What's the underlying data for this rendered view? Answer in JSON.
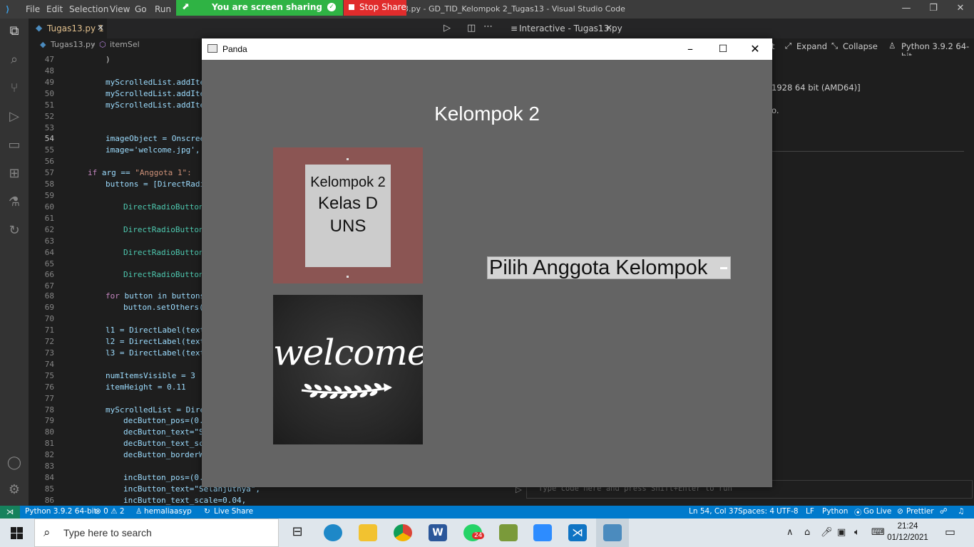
{
  "vscode": {
    "menu": [
      "File",
      "Edit",
      "Selection",
      "View",
      "Go",
      "Run"
    ],
    "window_title": "3.py - GD_TID_Kelompok 2_Tugas13 - Visual Studio Code",
    "editor_tab": {
      "label": "Tugas13.py 1",
      "close": "✕"
    },
    "breadcrumb": {
      "file": "Tugas13.py",
      "symbol": "itemSel"
    },
    "line_numbers": [
      "47",
      "48",
      "49",
      "50",
      "51",
      "52",
      "53",
      "54",
      "55",
      "56",
      "57",
      "58",
      "59",
      "60",
      "61",
      "62",
      "63",
      "64",
      "65",
      "66",
      "67",
      "68",
      "69",
      "70",
      "71",
      "72",
      "73",
      "74",
      "75",
      "76",
      "77",
      "78",
      "79",
      "80",
      "81",
      "82",
      "83",
      "84",
      "85",
      "86"
    ],
    "code": {
      "l47": ")",
      "l49": "myScrolledList.addIte",
      "l50": "myScrolledList.addIte",
      "l51": "myScrolledList.addIte",
      "l54": "imageObject = Onscree",
      "l55": "image='welcome.jpg',",
      "l57_kw": "if",
      "l57_rest": " arg == ",
      "l57_str": "\"Anggota 1\":",
      "l58": "buttons = [DirectRadi",
      "l60": "DirectRadioButton",
      "l62": "DirectRadioButton",
      "l64": "DirectRadioButton",
      "l66": "DirectRadioButton",
      "l68_kw": "for",
      "l68_rest": " button in buttons",
      "l69": "button.setOthers(",
      "l71": "l1 = DirectLabel(text",
      "l72": "l2 = DirectLabel(text",
      "l73": "l3 = DirectLabel(text",
      "l75": "numItemsVisible = 3",
      "l76": "itemHeight = 0.11",
      "l78": "myScrolledList = Dire",
      "l79": "decButton_pos=(0.",
      "l80": "decButton_text=\"S",
      "l81": "decButton_text_sc",
      "l82": "decButton_borderW",
      "l84": "incButton_pos=(0.",
      "l85": "incButton_text=\"Selanjutnya\",",
      "l86": "incButton_text_scale=0.04,"
    },
    "interactive": {
      "tab_label": "Interactive - Tugas13.py",
      "toolbar": {
        "t": "t",
        "expand": "Expand",
        "collapse": "Collapse",
        "kernel": "Python 3.9.2 64-bit"
      },
      "output_line1": "1928 64 bit (AMD64)]",
      "output_line2": "o.",
      "input_placeholder": "Type code here and press Shift+Enter to run"
    },
    "statusbar": {
      "python": "Python 3.9.2 64-bit",
      "errors": "⊗ 0 ⚠ 2",
      "user": "hemaliaasyp",
      "live_share": "Live Share",
      "position": "Ln 54, Col 37",
      "spaces": "Spaces: 4",
      "encoding": "UTF-8",
      "eol": "LF",
      "language": "Python",
      "go_live": "Go Live",
      "prettier": "Prettier"
    }
  },
  "screen_share": {
    "status": "You are screen sharing",
    "stop_label": "Stop Share"
  },
  "panda": {
    "title": "Panda",
    "heading": "Kelompok 2",
    "panel_lines": [
      "Kelompok 2",
      "Kelas D",
      "UNS"
    ],
    "image_text": "welcome",
    "dropdown_label": "Pilih Anggota Kelompok",
    "panel_color": "#8b5553"
  },
  "taskbar": {
    "search_placeholder": "Type here to search",
    "whatsapp_badge": "24",
    "time": "21:24",
    "date": "01/12/2021"
  },
  "colors": {
    "accent": "#007acc",
    "share_green": "#2fb344",
    "stop_red": "#e02c2c"
  }
}
